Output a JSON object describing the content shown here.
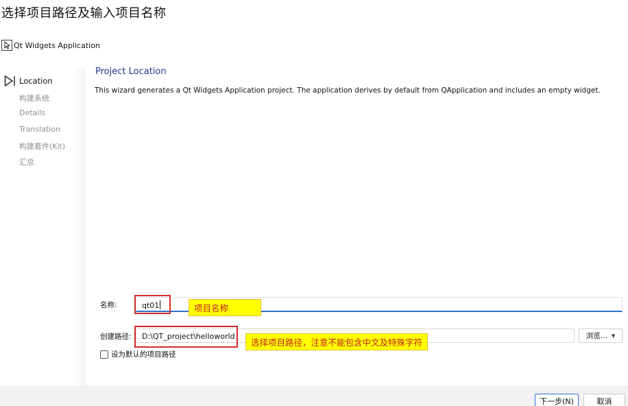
{
  "annotation_caption": "选择项目路径及输入项目名称",
  "wizard": {
    "title": "Qt Widgets Application",
    "steps": [
      {
        "label": "Location",
        "active": true
      },
      {
        "label": "构建系统",
        "active": false
      },
      {
        "label": "Details",
        "active": false
      },
      {
        "label": "Translation",
        "active": false
      },
      {
        "label": "构建套件(Kit)",
        "active": false
      },
      {
        "label": "汇总",
        "active": false
      }
    ],
    "section_title": "Project Location",
    "description": "This wizard generates a Qt Widgets Application project. The application derives by default from QApplication and includes an empty widget."
  },
  "form": {
    "name_label": "名称:",
    "name_value": "qt01",
    "path_label": "创建路径:",
    "path_value": "D:\\QT_project\\helloworld",
    "browse_label": "浏览...",
    "default_path_checkbox_label": "设为默认的项目路径",
    "default_path_checked": false
  },
  "annotations": {
    "name_note": "项目名称",
    "path_note": "选择项目路径，注意不能包含中文及特殊字符"
  },
  "footer": {
    "next_label": "下一步(N)",
    "cancel_label": "取消"
  },
  "colors": {
    "accent": "#2f6fd6",
    "section_title": "#1f3c8a",
    "annotation_border": "#d22a2a",
    "annotation_fill": "#ffff00",
    "annotation_text": "#c02020"
  }
}
